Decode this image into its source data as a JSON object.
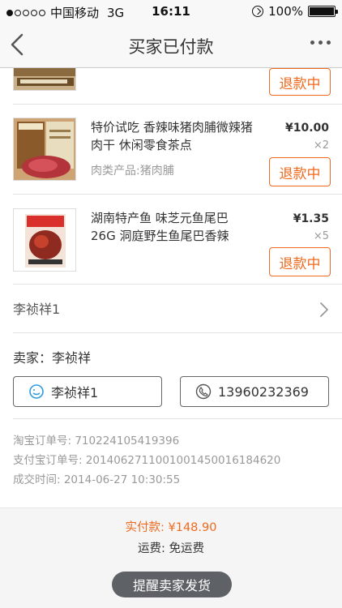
{
  "status_bar": {
    "carrier": "中国移动",
    "network": "3G",
    "time": "16:11",
    "battery": "100%"
  },
  "nav": {
    "title": "买家已付款",
    "back_icon": "chevron-left-icon",
    "more_icon": "more-dots-icon"
  },
  "items": [
    {
      "refund_label": "退款中"
    },
    {
      "title": "特价试吃 香辣味猪肉脯微辣猪肉干 休闲零食茶点",
      "attr": "肉类产品:猪肉脯",
      "price": "¥10.00",
      "qty": "×2",
      "refund_label": "退款中"
    },
    {
      "title": "湖南特产鱼 味芝元鱼尾巴26G 洞庭野生鱼尾巴香辣",
      "price": "¥1.35",
      "qty": "×5",
      "refund_label": "退款中"
    }
  ],
  "shop": {
    "name": "李祯祥1"
  },
  "seller": {
    "label": "卖家：李祯祥"
  },
  "contact": {
    "chat_label": "李祯祥1",
    "phone_label": "13960232369"
  },
  "order_info": {
    "taobao_no": "淘宝订单号:  710224105419396",
    "alipay_no": "支付宝订单号:  2014062711001001450016184620",
    "deal_time": "成交时间:  2014-06-27 10:30:55"
  },
  "summary": {
    "paid": "实付款:  ¥148.90",
    "shipping": "运费:  免运费",
    "remind_button": "提醒卖家发货"
  },
  "colors": {
    "accent": "#f06a1e",
    "button_dark": "#5e6266"
  }
}
